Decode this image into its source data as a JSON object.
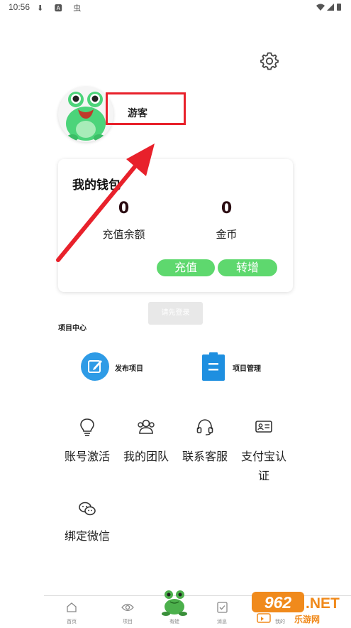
{
  "status_bar": {
    "time": "10:56",
    "left_icons": "⬇ 🅰 虫"
  },
  "header": {
    "settings_icon": "gear-icon",
    "guest_name": "游客"
  },
  "wallet": {
    "title": "我的钱包",
    "balance_value": "0",
    "balance_label": "充值余额",
    "coins_value": "0",
    "coins_label": "金币",
    "recharge_label": "充值",
    "transfer_label": "转增"
  },
  "login_button_label": "请先登录",
  "project_center": {
    "title": "项目中心",
    "publish_label": "发布项目",
    "manage_label": "项目管理"
  },
  "grid": {
    "items": [
      {
        "label": "账号激活",
        "icon": "lightbulb-icon"
      },
      {
        "label": "我的团队",
        "icon": "team-icon"
      },
      {
        "label": "联系客服",
        "icon": "headset-icon"
      },
      {
        "label": "支付宝认",
        "label2": "证",
        "icon": "id-card-icon"
      },
      {
        "label": "绑定微信",
        "icon": "wechat-icon"
      }
    ]
  },
  "bottom_nav": {
    "items": [
      {
        "label": "首页"
      },
      {
        "label": "项目"
      },
      {
        "label": "有蛙"
      },
      {
        "label": "消息"
      },
      {
        "label": "我的"
      }
    ]
  },
  "watermark": {
    "number": "962",
    "suffix": ".NET",
    "sub": "乐游网"
  },
  "colors": {
    "accent_green": "#5ed86e",
    "annotation_red": "#e8212b",
    "publish_blue": "#2e9be6",
    "manage_blue": "#1e8fe0"
  }
}
